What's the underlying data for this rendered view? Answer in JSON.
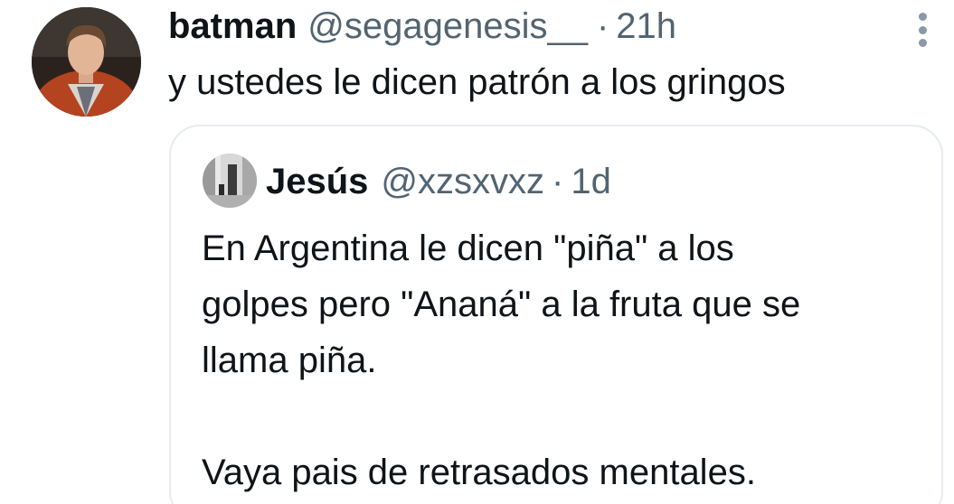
{
  "tweet": {
    "display_name": "batman",
    "handle": "@segagenesis__",
    "separator": "·",
    "time": "21h",
    "text": "y ustedes le dicen patrón a los gringos",
    "avatar_icon": "user-avatar-photo",
    "more_icon": "more-options-icon"
  },
  "quoted_tweet": {
    "display_name": "Jesús",
    "handle": "@xzsxvxz",
    "separator": "·",
    "time": "1d",
    "avatar_icon": "user-avatar-photo",
    "lines": [
      "En Argentina le dicen \"piña\" a los",
      "golpes pero \"Ananá\" a la fruta que se",
      "llama piña.",
      "Vaya pais de retrasados mentales."
    ]
  },
  "colors": {
    "text_primary": "#0f1419",
    "text_secondary": "#536471",
    "border": "#e6ecf0"
  }
}
